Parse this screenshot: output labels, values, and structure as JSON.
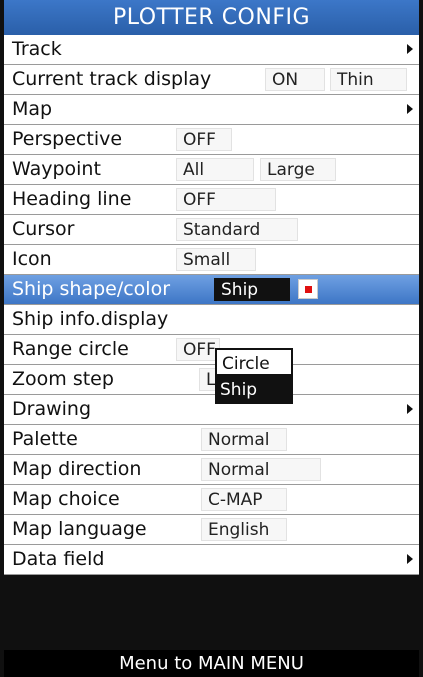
{
  "title": "PLOTTER CONFIG",
  "rows": [
    {
      "label": "Track"
    },
    {
      "label": "Current track display",
      "value": "ON",
      "value2": "Thin"
    },
    {
      "label": "Map"
    },
    {
      "label": "Perspective",
      "value": "OFF"
    },
    {
      "label": "Waypoint",
      "value": "All",
      "value2": "Large"
    },
    {
      "label": "Heading line",
      "value": "OFF"
    },
    {
      "label": "Cursor",
      "value": "Standard"
    },
    {
      "label": "Icon",
      "value": "Small"
    },
    {
      "label": "Ship shape/color",
      "value": "Ship",
      "color": "#e01010"
    },
    {
      "label": "Ship info.display"
    },
    {
      "label": "Range circle",
      "value": "OFF"
    },
    {
      "label": "Zoom step",
      "value": "Less"
    },
    {
      "label": "Drawing"
    },
    {
      "label": "Palette",
      "value": "Normal"
    },
    {
      "label": "Map direction",
      "value": "Normal"
    },
    {
      "label": "Map choice",
      "value": "C-MAP"
    },
    {
      "label": "Map language",
      "value": "English"
    },
    {
      "label": "Data field"
    }
  ],
  "dropdown": {
    "options": [
      "Circle",
      "Ship"
    ],
    "highlighted": "Ship"
  },
  "footer": "Menu to MAIN MENU",
  "colors": {
    "title_bar": "#3468b8",
    "selection": "#4a82cf",
    "ship_color": "#e01010"
  }
}
